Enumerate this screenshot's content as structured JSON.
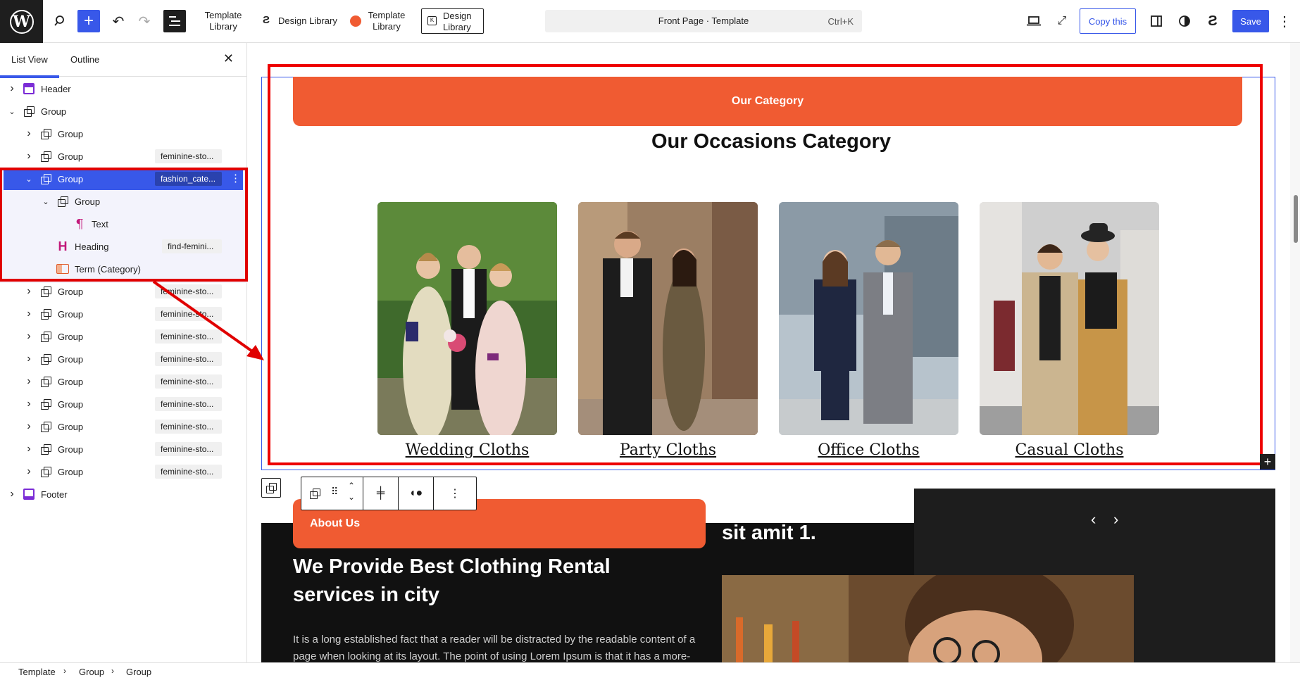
{
  "toolbar": {
    "template_library_1": "Template\nLibrary",
    "design_library_1": "Design Library",
    "template_library_2": "Template\nLibrary",
    "design_library_2": "Design\nLibrary",
    "doc_title": "Front Page · Template",
    "shortcut": "Ctrl+K",
    "copy_label": "Copy this",
    "save_label": "Save"
  },
  "sidebar": {
    "tabs": [
      "List View",
      "Outline"
    ],
    "rows": [
      {
        "label": "Header",
        "type": "header",
        "level": 0,
        "chevron": "right",
        "badge": ""
      },
      {
        "label": "Group",
        "type": "group",
        "level": 0,
        "chevron": "down",
        "badge": ""
      },
      {
        "label": "Group",
        "type": "group",
        "level": 1,
        "chevron": "right",
        "badge": ""
      },
      {
        "label": "Group",
        "type": "group",
        "level": 1,
        "chevron": "right",
        "badge": "feminine-sto..."
      },
      {
        "label": "Group",
        "type": "group",
        "level": 1,
        "chevron": "down",
        "badge": "fashion_cate...",
        "selected": true
      },
      {
        "label": "Group",
        "type": "group",
        "level": 2,
        "chevron": "down",
        "badge": ""
      },
      {
        "label": "Text",
        "type": "paragraph",
        "level": 3,
        "chevron": "",
        "badge": ""
      },
      {
        "label": "Heading",
        "type": "heading",
        "level": 2,
        "chevron": "",
        "badge": "find-femini..."
      },
      {
        "label": "Term (Category)",
        "type": "term",
        "level": 2,
        "chevron": "",
        "badge": ""
      },
      {
        "label": "Group",
        "type": "group",
        "level": 1,
        "chevron": "right",
        "badge": "feminine-sto..."
      },
      {
        "label": "Group",
        "type": "group",
        "level": 1,
        "chevron": "right",
        "badge": "feminine-sto..."
      },
      {
        "label": "Group",
        "type": "group",
        "level": 1,
        "chevron": "right",
        "badge": "feminine-sto..."
      },
      {
        "label": "Group",
        "type": "group",
        "level": 1,
        "chevron": "right",
        "badge": "feminine-sto..."
      },
      {
        "label": "Group",
        "type": "group",
        "level": 1,
        "chevron": "right",
        "badge": "feminine-sto..."
      },
      {
        "label": "Group",
        "type": "group",
        "level": 1,
        "chevron": "right",
        "badge": "feminine-sto..."
      },
      {
        "label": "Group",
        "type": "group",
        "level": 1,
        "chevron": "right",
        "badge": "feminine-sto..."
      },
      {
        "label": "Group",
        "type": "group",
        "level": 1,
        "chevron": "right",
        "badge": "feminine-sto..."
      },
      {
        "label": "Group",
        "type": "group",
        "level": 1,
        "chevron": "right",
        "badge": "feminine-sto..."
      },
      {
        "label": "Footer",
        "type": "footer",
        "level": 0,
        "chevron": "right",
        "badge": ""
      }
    ]
  },
  "breadcrumb": [
    "Template",
    "Group",
    "Group"
  ],
  "canvas": {
    "category_pill": "Our Category",
    "occasions_title": "Our Occasions Category",
    "categories": [
      "Wedding Cloths",
      "Party Cloths",
      "Office Cloths",
      "Casual Cloths"
    ],
    "about_pill": "About Us",
    "about_title": "We Provide Best Clothing  Rental services in city",
    "about_body": "It is a long established fact that a reader will be distracted by the readable content of a page when looking at its layout. The point of using Lorem Ipsum is that it has a more-",
    "amit_text": "sit amit 1."
  },
  "colors": {
    "accent": "#3858e9",
    "brand_orange": "#f05b32",
    "annotation_red": "#e00000"
  }
}
